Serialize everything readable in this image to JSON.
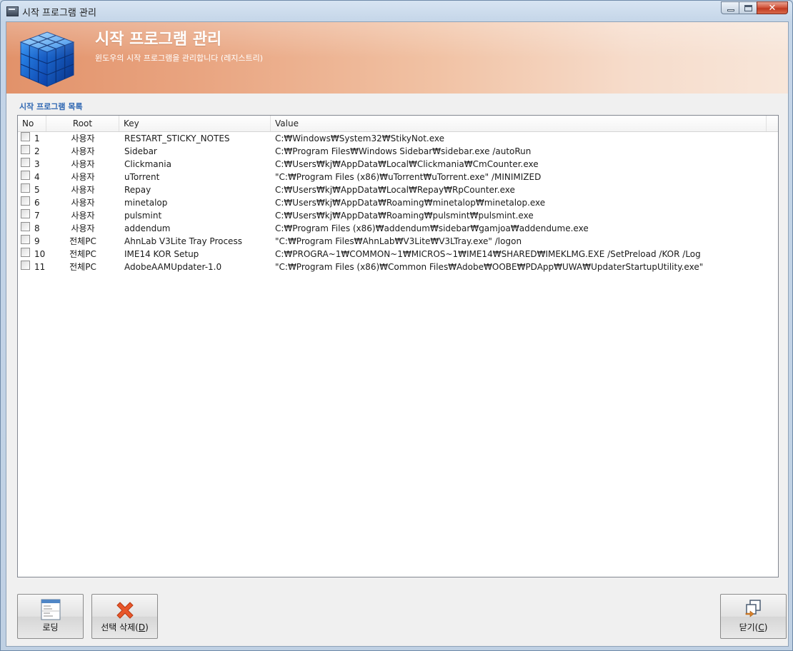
{
  "window": {
    "title": "시작 프로그램 관리"
  },
  "banner": {
    "title": "시작 프로그램 관리",
    "subtitle": "윈도우의 시작 프로그램을 관리합니다 (레지스트리)"
  },
  "section_label": "시작 프로그램 목록",
  "list": {
    "columns": {
      "no": "No",
      "root": "Root",
      "key": "Key",
      "value": "Value"
    },
    "rows": [
      {
        "no": "1",
        "root": "사용자",
        "key": "RESTART_STICKY_NOTES",
        "value": "C:₩Windows₩System32₩StikyNot.exe"
      },
      {
        "no": "2",
        "root": "사용자",
        "key": "Sidebar",
        "value": "C:₩Program Files₩Windows Sidebar₩sidebar.exe /autoRun"
      },
      {
        "no": "3",
        "root": "사용자",
        "key": "Clickmania",
        "value": "C:₩Users₩kj₩AppData₩Local₩Clickmania₩CmCounter.exe"
      },
      {
        "no": "4",
        "root": "사용자",
        "key": "uTorrent",
        "value": "\"C:₩Program Files (x86)₩uTorrent₩uTorrent.exe\"  /MINIMIZED"
      },
      {
        "no": "5",
        "root": "사용자",
        "key": "Repay",
        "value": "C:₩Users₩kj₩AppData₩Local₩Repay₩RpCounter.exe"
      },
      {
        "no": "6",
        "root": "사용자",
        "key": "minetalop",
        "value": "C:₩Users₩kj₩AppData₩Roaming₩minetalop₩minetalop.exe"
      },
      {
        "no": "7",
        "root": "사용자",
        "key": "pulsmint",
        "value": "C:₩Users₩kj₩AppData₩Roaming₩pulsmint₩pulsmint.exe"
      },
      {
        "no": "8",
        "root": "사용자",
        "key": "addendum",
        "value": "C:₩Program Files (x86)₩addendum₩sidebar₩gamjoa₩addendume.exe"
      },
      {
        "no": "9",
        "root": "전체PC",
        "key": "AhnLab V3Lite Tray Process",
        "value": "\"C:₩Program Files₩AhnLab₩V3Lite₩V3LTray.exe\" /logon"
      },
      {
        "no": "10",
        "root": "전체PC",
        "key": "IME14 KOR Setup",
        "value": "C:₩PROGRA~1₩COMMON~1₩MICROS~1₩IME14₩SHARED₩IMEKLMG.EXE /SetPreload /KOR /Log"
      },
      {
        "no": "11",
        "root": "전체PC",
        "key": "AdobeAAMUpdater-1.0",
        "value": "\"C:₩Program Files (x86)₩Common Files₩Adobe₩OOBE₩PDApp₩UWA₩UpdaterStartupUtility.exe\""
      }
    ]
  },
  "buttons": {
    "load": {
      "label": "로딩",
      "icon": "file-menu-icon"
    },
    "delete": {
      "label": "선택 삭제(",
      "hotkey": "D",
      "suffix": ")",
      "icon": "red-x-icon"
    },
    "close": {
      "label": "닫기(",
      "hotkey": "C",
      "suffix": ")",
      "icon": "window-exit-icon"
    }
  },
  "colors": {
    "section_label": "#2f67b2",
    "banner_start": "#e2926a",
    "banner_end": "#f8e6d9",
    "delete_icon": "#e8562a"
  }
}
